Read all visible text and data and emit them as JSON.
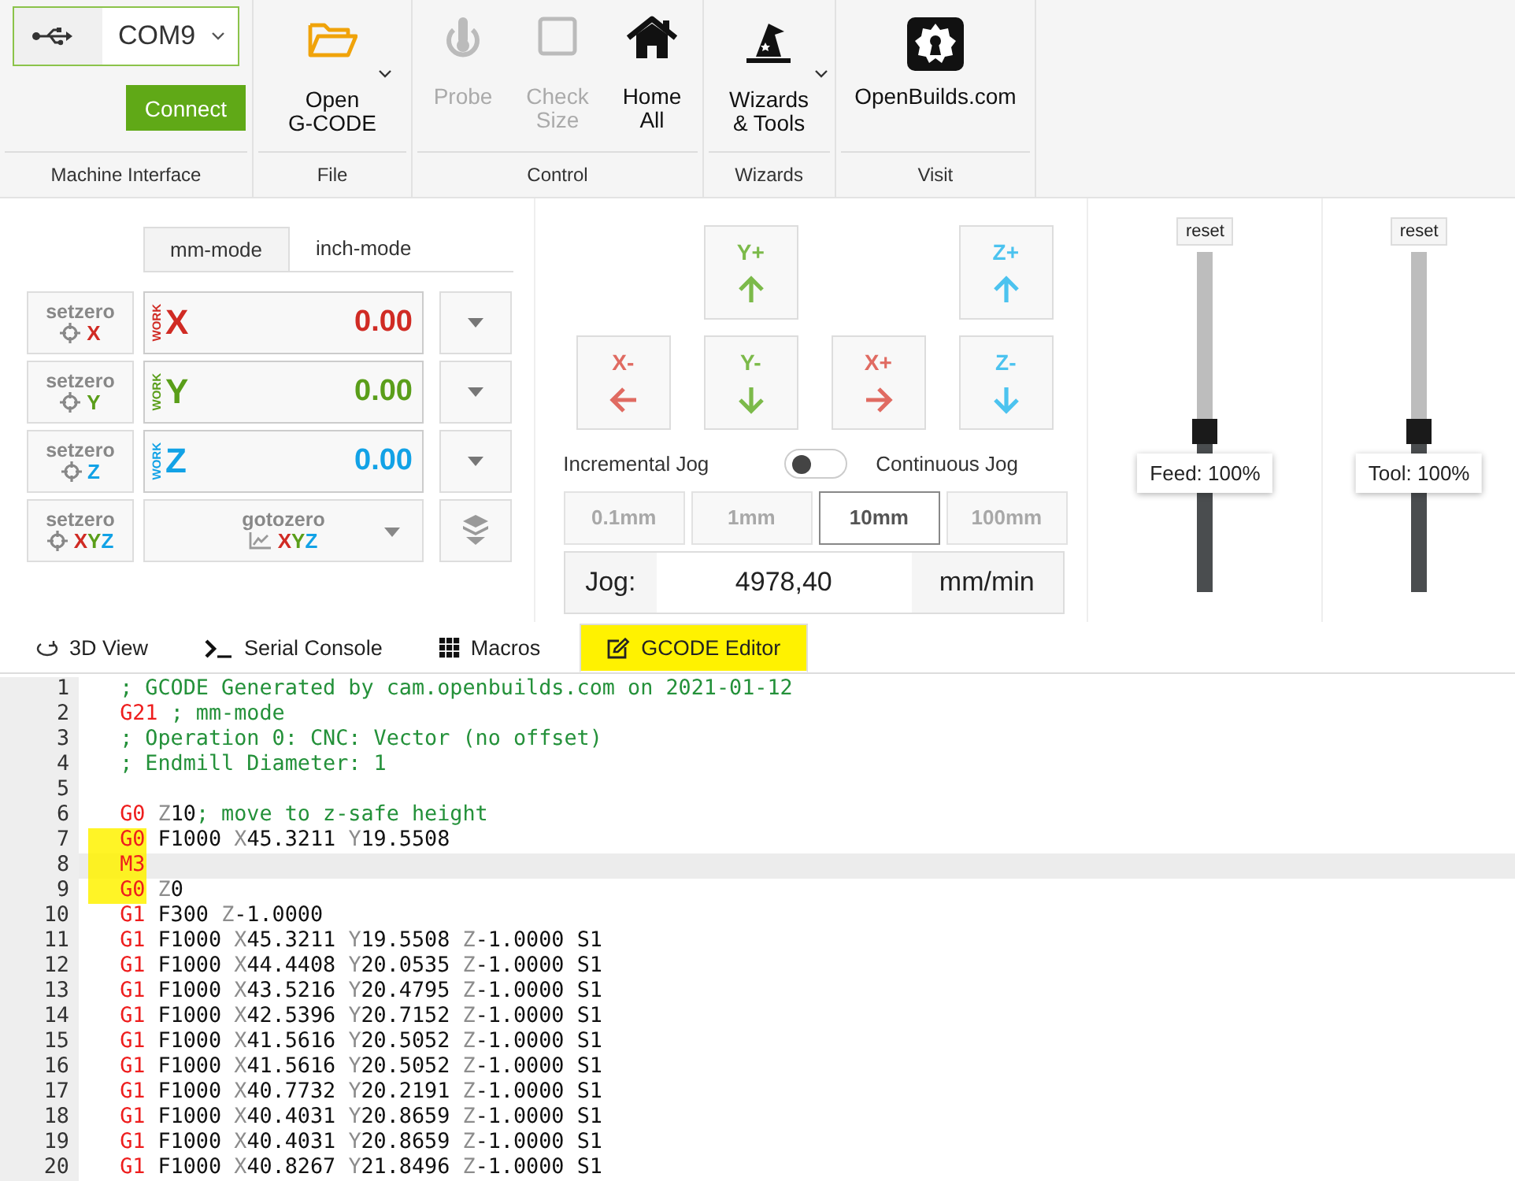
{
  "ribbon": {
    "port": "COM9",
    "connect": "Connect",
    "groups": [
      {
        "label": "Machine Interface"
      },
      {
        "label": "File",
        "tools": [
          {
            "lines": [
              "Open",
              "G-CODE"
            ],
            "disabled": false,
            "menu": true
          }
        ]
      },
      {
        "label": "Control",
        "tools": [
          {
            "lines": [
              "Probe"
            ],
            "disabled": true,
            "menu": false
          },
          {
            "lines": [
              "Check",
              "Size"
            ],
            "disabled": true,
            "menu": false
          },
          {
            "lines": [
              "Home",
              "All"
            ],
            "disabled": false,
            "menu": false
          }
        ]
      },
      {
        "label": "Wizards",
        "tools": [
          {
            "lines": [
              "Wizards",
              "& Tools"
            ],
            "disabled": false,
            "menu": true
          }
        ]
      },
      {
        "label": "Visit",
        "tools": [
          {
            "lines": [
              "OpenBuilds.com"
            ],
            "disabled": false,
            "menu": false
          }
        ]
      }
    ]
  },
  "units": [
    {
      "label": "mm-mode",
      "selected": true
    },
    {
      "label": "inch-mode",
      "selected": false
    }
  ],
  "axes": [
    {
      "setzero": "setzero",
      "setzero_axis": "X",
      "axis": "X",
      "work": "WORK",
      "value": "0.00",
      "color": "#d02b24"
    },
    {
      "setzero": "setzero",
      "setzero_axis": "Y",
      "axis": "Y",
      "work": "WORK",
      "value": "0.00",
      "color": "#5a9e1a"
    },
    {
      "setzero": "setzero",
      "setzero_axis": "Z",
      "axis": "Z",
      "work": "WORK",
      "value": "0.00",
      "color": "#12a2e6"
    }
  ],
  "all_axes": {
    "setzero": "setzero",
    "setzero_letters": [
      {
        "text": "X",
        "color": "#d02b24"
      },
      {
        "text": "Y",
        "color": "#5a9e1a"
      },
      {
        "text": "Z",
        "color": "#12a2e6"
      }
    ],
    "gotozero": "gotozero",
    "gotozero_letters": [
      {
        "text": "X",
        "color": "#d02b24"
      },
      {
        "text": "Y",
        "color": "#5a9e1a"
      },
      {
        "text": "Z",
        "color": "#12a2e6"
      }
    ]
  },
  "jog": {
    "buttons": [
      {
        "label": "Y+",
        "kind": "up",
        "color": "#7cba4a"
      },
      {
        "label": "Z+",
        "kind": "up",
        "color": "#4cc3ef"
      },
      {
        "label": "X-",
        "kind": "left",
        "color": "#e06b62"
      },
      {
        "label": "Y-",
        "kind": "down",
        "color": "#7cba4a"
      },
      {
        "label": "X+",
        "kind": "right",
        "color": "#e06b62"
      },
      {
        "label": "Z-",
        "kind": "down",
        "color": "#4cc3ef"
      }
    ],
    "toggle": {
      "left": "Incremental Jog",
      "right": "Continuous Jog",
      "on": false
    },
    "steps": [
      {
        "label": "0.1mm",
        "selected": false
      },
      {
        "label": "1mm",
        "selected": false
      },
      {
        "label": "10mm",
        "selected": true
      },
      {
        "label": "100mm",
        "selected": false
      }
    ],
    "rate": {
      "label": "Jog:",
      "value": "4978,40",
      "unit": "mm/min"
    }
  },
  "overrides": [
    {
      "reset": "reset",
      "label": "Feed: 100%",
      "level": 0.47
    },
    {
      "reset": "reset",
      "label": "Tool: 100%",
      "level": 0.47
    }
  ],
  "tabs": [
    {
      "label": "3D View",
      "selected": false,
      "highlighted": false
    },
    {
      "label": "Serial Console",
      "selected": false,
      "highlighted": false
    },
    {
      "label": "Macros",
      "selected": false,
      "highlighted": false
    },
    {
      "label": "GCODE Editor",
      "selected": true,
      "highlighted": true
    }
  ],
  "editor": {
    "lines": [
      {
        "number": "1",
        "code": "; GCODE Generated by cam.openbuilds.com on 2021-01-12",
        "active": false,
        "highlighted": false
      },
      {
        "number": "2",
        "code": "G21 ; mm-mode",
        "active": false,
        "highlighted": false
      },
      {
        "number": "3",
        "code": "; Operation 0: CNC: Vector (no offset)",
        "active": false,
        "highlighted": false
      },
      {
        "number": "4",
        "code": "; Endmill Diameter: 1",
        "active": false,
        "highlighted": false
      },
      {
        "number": "5",
        "active": false,
        "highlighted": false
      },
      {
        "number": "6",
        "code": "G0 Z10; move to z-safe height",
        "active": false,
        "highlighted": false
      },
      {
        "number": "7",
        "code": "G0 F1000 X45.3211 Y19.5508",
        "active": false,
        "highlighted": true
      },
      {
        "number": "8",
        "code": "M3",
        "active": true,
        "highlighted": true
      },
      {
        "number": "9",
        "code": "G0 Z0",
        "active": false,
        "highlighted": true
      },
      {
        "number": "10",
        "code": "G1 F300 Z-1.0000",
        "active": false,
        "highlighted": false
      },
      {
        "number": "11",
        "code": "G1 F1000 X45.3211 Y19.5508 Z-1.0000 S1",
        "active": false,
        "highlighted": false
      },
      {
        "number": "12",
        "code": "G1 F1000 X44.4408 Y20.0535 Z-1.0000 S1",
        "active": false,
        "highlighted": false
      },
      {
        "number": "13",
        "code": "G1 F1000 X43.5216 Y20.4795 Z-1.0000 S1",
        "active": false,
        "highlighted": false
      },
      {
        "number": "14",
        "code": "G1 F1000 X42.5396 Y20.7152 Z-1.0000 S1",
        "active": false,
        "highlighted": false
      },
      {
        "number": "15",
        "code": "G1 F1000 X41.5616 Y20.5052 Z-1.0000 S1",
        "active": false,
        "highlighted": false
      },
      {
        "number": "16",
        "code": "G1 F1000 X41.5616 Y20.5052 Z-1.0000 S1",
        "active": false,
        "highlighted": false
      },
      {
        "number": "17",
        "code": "G1 F1000 X40.7732 Y20.2191 Z-1.0000 S1",
        "active": false,
        "highlighted": false
      },
      {
        "number": "18",
        "code": "G1 F1000 X40.4031 Y20.8659 Z-1.0000 S1",
        "active": false,
        "highlighted": false
      },
      {
        "number": "19",
        "code": "G1 F1000 X40.4031 Y20.8659 Z-1.0000 S1",
        "active": false,
        "highlighted": false
      },
      {
        "number": "20",
        "code": "G1 F1000 X40.8267 Y21.8496 Z-1.0000 S1",
        "active": false,
        "highlighted": false
      }
    ]
  }
}
